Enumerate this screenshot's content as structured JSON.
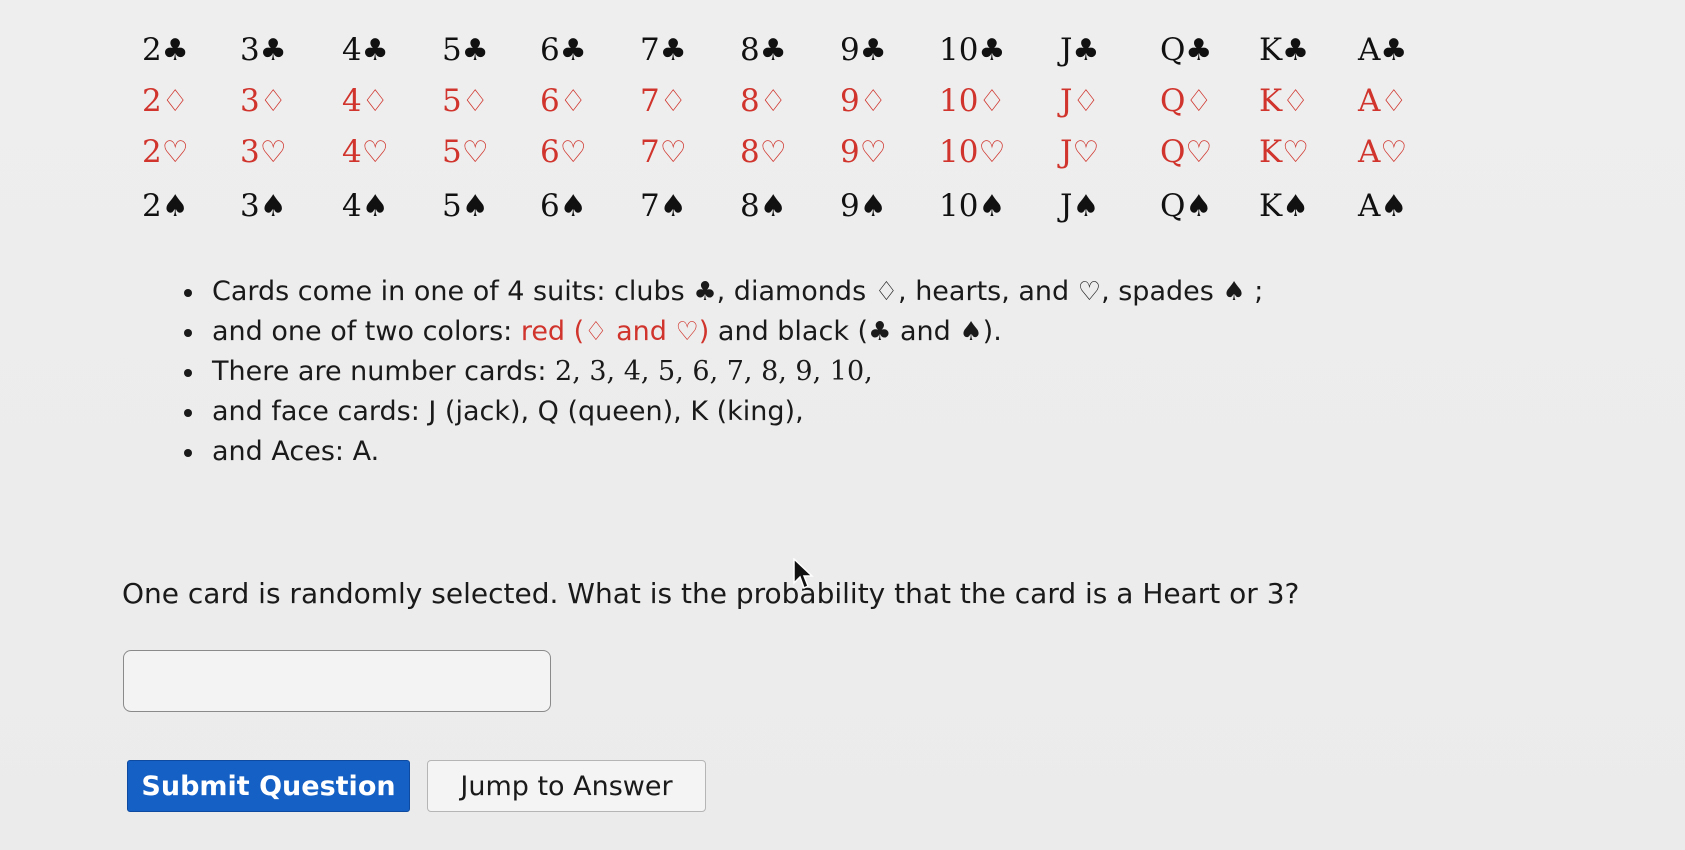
{
  "cards": {
    "ranks": [
      "2",
      "3",
      "4",
      "5",
      "6",
      "7",
      "8",
      "9",
      "10",
      "J",
      "Q",
      "K",
      "A"
    ],
    "rows": [
      {
        "suit": "♣",
        "color": "black",
        "name": "clubs"
      },
      {
        "suit": "♢",
        "color": "red",
        "name": "diamonds"
      },
      {
        "suit": "♡",
        "color": "red",
        "name": "hearts"
      },
      {
        "suit": "♠",
        "color": "black",
        "name": "spades"
      }
    ],
    "colors": {
      "red": "#d0342c",
      "black": "#111111"
    }
  },
  "bullets": {
    "b1": {
      "text1": "Cards come in one of 4 suits: clubs ",
      "club": "♣",
      "text2": ", diamonds ",
      "diamond": "♢",
      "text3": ", hearts, and ",
      "heart": "♡",
      "text4": ", spades ",
      "spade": "♠",
      "text5": " ;"
    },
    "b2": {
      "text1": "and one of two colors: ",
      "red_open": "red (",
      "diamond": "♢",
      "and": " and ",
      "heart": "♡",
      "red_close": ")",
      "text2": " and black (",
      "club": "♣",
      "and2": " and ",
      "spade": "♠",
      "text3": ")."
    },
    "b3": {
      "text": "There are number cards: ",
      "numbers": "2, 3, 4, 5, 6, 7, 8, 9, 10,"
    },
    "b4": {
      "text": "and face cards: J (jack), Q (queen), K (king),"
    },
    "b5": {
      "text": "and Aces: A."
    }
  },
  "question": {
    "text": "One card is randomly selected. What is the probability that the card is a Heart or 3?"
  },
  "answer": {
    "value": "",
    "placeholder": ""
  },
  "buttons": {
    "submit": "Submit Question",
    "jump": "Jump to Answer"
  },
  "theme": {
    "submit_bg": "#1560c5",
    "submit_text": "#ffffff",
    "page_bg": "#ececec"
  }
}
